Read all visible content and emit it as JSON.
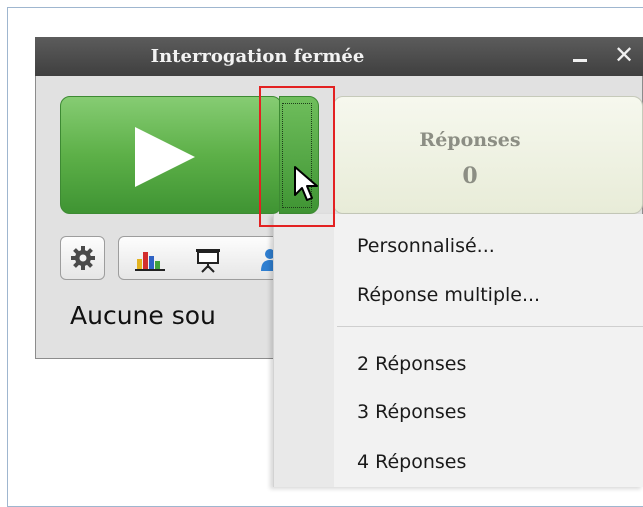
{
  "window": {
    "title": "Interrogation fermée",
    "minimize_icon": "minimize-icon",
    "close_icon": "close-icon"
  },
  "controls": {
    "play_icon": "play-icon",
    "responses_label": "Réponses",
    "responses_count": "0"
  },
  "toolbar": {
    "icons": [
      "gear-icon",
      "bar-chart-icon",
      "presentation-board-icon",
      "user-icon"
    ]
  },
  "status": {
    "text": "Aucune sou"
  },
  "menu": {
    "items": [
      {
        "label": "Personnalisé..."
      },
      {
        "label": "Réponse multiple..."
      },
      {
        "label": "2 Réponses"
      },
      {
        "label": "3 Réponses"
      },
      {
        "label": "4 Réponses"
      }
    ]
  },
  "colors": {
    "titlebar": "#4a4a4a",
    "play_green": "#5db048",
    "highlight_red": "#e32121",
    "responses_bg": "#eef1e1"
  }
}
